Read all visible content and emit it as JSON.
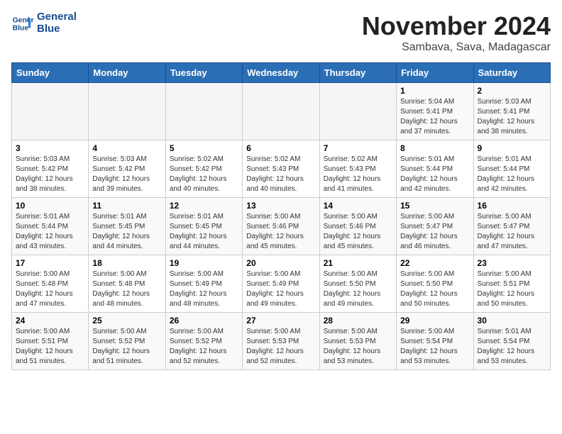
{
  "logo": {
    "line1": "General",
    "line2": "Blue"
  },
  "title": "November 2024",
  "location": "Sambava, Sava, Madagascar",
  "days_of_week": [
    "Sunday",
    "Monday",
    "Tuesday",
    "Wednesday",
    "Thursday",
    "Friday",
    "Saturday"
  ],
  "weeks": [
    [
      {
        "day": "",
        "info": ""
      },
      {
        "day": "",
        "info": ""
      },
      {
        "day": "",
        "info": ""
      },
      {
        "day": "",
        "info": ""
      },
      {
        "day": "",
        "info": ""
      },
      {
        "day": "1",
        "info": "Sunrise: 5:04 AM\nSunset: 5:41 PM\nDaylight: 12 hours\nand 37 minutes."
      },
      {
        "day": "2",
        "info": "Sunrise: 5:03 AM\nSunset: 5:41 PM\nDaylight: 12 hours\nand 38 minutes."
      }
    ],
    [
      {
        "day": "3",
        "info": "Sunrise: 5:03 AM\nSunset: 5:42 PM\nDaylight: 12 hours\nand 38 minutes."
      },
      {
        "day": "4",
        "info": "Sunrise: 5:03 AM\nSunset: 5:42 PM\nDaylight: 12 hours\nand 39 minutes."
      },
      {
        "day": "5",
        "info": "Sunrise: 5:02 AM\nSunset: 5:42 PM\nDaylight: 12 hours\nand 40 minutes."
      },
      {
        "day": "6",
        "info": "Sunrise: 5:02 AM\nSunset: 5:43 PM\nDaylight: 12 hours\nand 40 minutes."
      },
      {
        "day": "7",
        "info": "Sunrise: 5:02 AM\nSunset: 5:43 PM\nDaylight: 12 hours\nand 41 minutes."
      },
      {
        "day": "8",
        "info": "Sunrise: 5:01 AM\nSunset: 5:44 PM\nDaylight: 12 hours\nand 42 minutes."
      },
      {
        "day": "9",
        "info": "Sunrise: 5:01 AM\nSunset: 5:44 PM\nDaylight: 12 hours\nand 42 minutes."
      }
    ],
    [
      {
        "day": "10",
        "info": "Sunrise: 5:01 AM\nSunset: 5:44 PM\nDaylight: 12 hours\nand 43 minutes."
      },
      {
        "day": "11",
        "info": "Sunrise: 5:01 AM\nSunset: 5:45 PM\nDaylight: 12 hours\nand 44 minutes."
      },
      {
        "day": "12",
        "info": "Sunrise: 5:01 AM\nSunset: 5:45 PM\nDaylight: 12 hours\nand 44 minutes."
      },
      {
        "day": "13",
        "info": "Sunrise: 5:00 AM\nSunset: 5:46 PM\nDaylight: 12 hours\nand 45 minutes."
      },
      {
        "day": "14",
        "info": "Sunrise: 5:00 AM\nSunset: 5:46 PM\nDaylight: 12 hours\nand 45 minutes."
      },
      {
        "day": "15",
        "info": "Sunrise: 5:00 AM\nSunset: 5:47 PM\nDaylight: 12 hours\nand 46 minutes."
      },
      {
        "day": "16",
        "info": "Sunrise: 5:00 AM\nSunset: 5:47 PM\nDaylight: 12 hours\nand 47 minutes."
      }
    ],
    [
      {
        "day": "17",
        "info": "Sunrise: 5:00 AM\nSunset: 5:48 PM\nDaylight: 12 hours\nand 47 minutes."
      },
      {
        "day": "18",
        "info": "Sunrise: 5:00 AM\nSunset: 5:48 PM\nDaylight: 12 hours\nand 48 minutes."
      },
      {
        "day": "19",
        "info": "Sunrise: 5:00 AM\nSunset: 5:49 PM\nDaylight: 12 hours\nand 48 minutes."
      },
      {
        "day": "20",
        "info": "Sunrise: 5:00 AM\nSunset: 5:49 PM\nDaylight: 12 hours\nand 49 minutes."
      },
      {
        "day": "21",
        "info": "Sunrise: 5:00 AM\nSunset: 5:50 PM\nDaylight: 12 hours\nand 49 minutes."
      },
      {
        "day": "22",
        "info": "Sunrise: 5:00 AM\nSunset: 5:50 PM\nDaylight: 12 hours\nand 50 minutes."
      },
      {
        "day": "23",
        "info": "Sunrise: 5:00 AM\nSunset: 5:51 PM\nDaylight: 12 hours\nand 50 minutes."
      }
    ],
    [
      {
        "day": "24",
        "info": "Sunrise: 5:00 AM\nSunset: 5:51 PM\nDaylight: 12 hours\nand 51 minutes."
      },
      {
        "day": "25",
        "info": "Sunrise: 5:00 AM\nSunset: 5:52 PM\nDaylight: 12 hours\nand 51 minutes."
      },
      {
        "day": "26",
        "info": "Sunrise: 5:00 AM\nSunset: 5:52 PM\nDaylight: 12 hours\nand 52 minutes."
      },
      {
        "day": "27",
        "info": "Sunrise: 5:00 AM\nSunset: 5:53 PM\nDaylight: 12 hours\nand 52 minutes."
      },
      {
        "day": "28",
        "info": "Sunrise: 5:00 AM\nSunset: 5:53 PM\nDaylight: 12 hours\nand 53 minutes."
      },
      {
        "day": "29",
        "info": "Sunrise: 5:00 AM\nSunset: 5:54 PM\nDaylight: 12 hours\nand 53 minutes."
      },
      {
        "day": "30",
        "info": "Sunrise: 5:01 AM\nSunset: 5:54 PM\nDaylight: 12 hours\nand 53 minutes."
      }
    ]
  ]
}
